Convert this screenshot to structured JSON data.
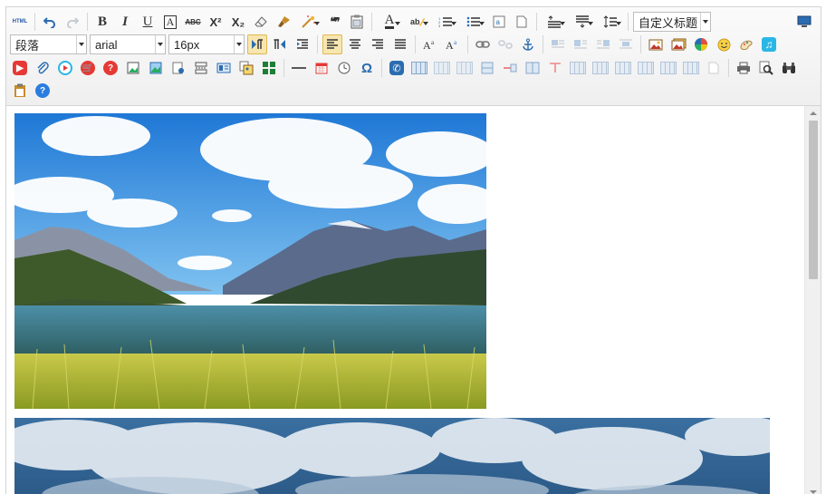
{
  "toolbar": {
    "html_label": "HTML",
    "bold": "B",
    "italic": "I",
    "underline": "U",
    "font_border": "A",
    "strike": "ABC",
    "sup": "X²",
    "sub": "X₂",
    "quote": "❝❞",
    "font_color": "A",
    "custom_title": "自定义标题",
    "paragraph": "段落",
    "font_family": "arial",
    "font_size": "16px",
    "omega": "Ω"
  },
  "colors": {
    "toolbar_bg": "#f2f2f2",
    "active_bg": "#f7e6b0",
    "scroll_thumb": "#c1c1c1"
  },
  "content": {
    "images": [
      "mountain-lake-photo",
      "cloudy-sky-photo"
    ]
  }
}
